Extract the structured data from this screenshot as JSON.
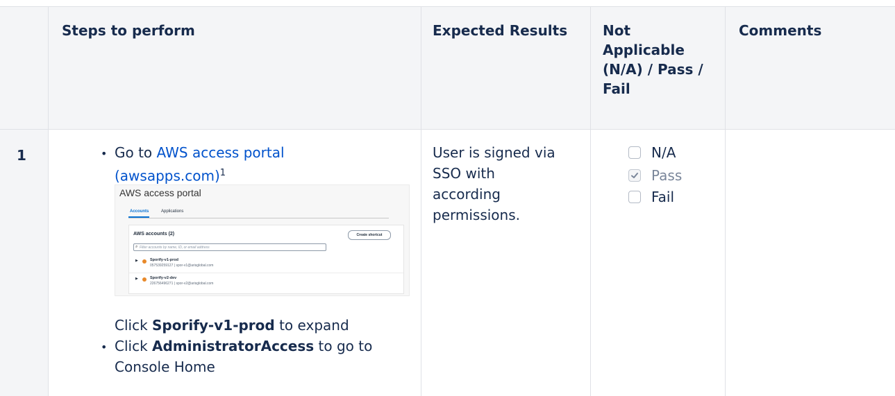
{
  "table": {
    "headers": [
      "Steps to perform",
      "Expected Results",
      "Not Applicable (N/A) / Pass / Fail",
      "Comments"
    ],
    "header_lines": {
      "status": [
        "Not",
        "Applicable",
        "(N/A) / Pass /",
        "Fail"
      ]
    },
    "rows": [
      {
        "number": "1",
        "steps": {
          "link_text_line1": "AWS access portal",
          "link_text_line2": "(awsapps.com)",
          "go_to": "Go to",
          "footnote": "1",
          "click_prefix": "Click",
          "click_bold": "Sporify-v1-prod",
          "click_suffix": "to expand",
          "click2_prefix": "Click",
          "click2_bold": "AdministratorAccess",
          "click2_suffix": "to go to",
          "click2_line2": "Console Home"
        },
        "expected_lines": [
          "User is signed via",
          "SSO with",
          "according",
          "permissions."
        ],
        "options": [
          {
            "label": "N/A",
            "checked": false
          },
          {
            "label": "Pass",
            "checked": true
          },
          {
            "label": "Fail",
            "checked": false
          }
        ],
        "comments": ""
      }
    ]
  },
  "screenshot": {
    "title": "AWS access portal",
    "tabs": [
      "Accounts",
      "Applications"
    ],
    "heading": "AWS accounts (2)",
    "button": "Create shortcut",
    "search_placeholder": "Filter accounts by name, ID, or email address",
    "accounts": [
      {
        "name": "Sporify-v1-prod",
        "details": "057539259127 | spor-v1@arisglobal.com"
      },
      {
        "name": "Sporify-v2-dev",
        "details": "226756496271 | spor-v2@arisglobal.com"
      }
    ]
  },
  "colors": {
    "link": "#0052cc",
    "header_bg": "#f4f5f7",
    "border": "#dfe1e6",
    "accent_orange": "#e8892a"
  }
}
